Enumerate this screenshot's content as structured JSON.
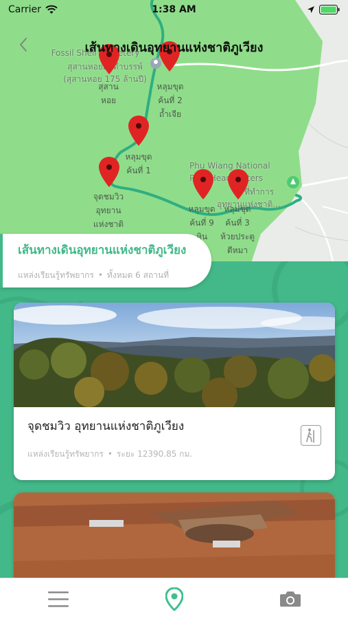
{
  "status_bar": {
    "carrier": "Carrier",
    "time": "1:38 AM",
    "icons": [
      "wifi-icon",
      "location-arrow-icon",
      "battery-icon"
    ]
  },
  "map": {
    "title": "เส้นทางเดินอุทยานแห่งชาติภูเวียง",
    "places": [
      {
        "label": "Fossil Shell Cemetery"
      },
      {
        "label": "สุสานหอยดึกดำบรรพ์"
      },
      {
        "label": "(สุสานหอย 175 ล้านปี)"
      },
      {
        "label": "Phu Wiang National Park Headquaters"
      },
      {
        "label": "ที่ทำการ"
      },
      {
        "label": "อุทยานแห่งชาติ..."
      }
    ],
    "pins": [
      {
        "label": "สุสาน\nหอย"
      },
      {
        "label": "หลุมขุด\nค้นที่ 2\nถ้ำเจีย"
      },
      {
        "label": "หลุมขุด\nค้นที่ 1"
      },
      {
        "label": "จุดชมวิว\nอุทยาน\nแห่งชาติ"
      },
      {
        "label": "หลุมขุด\nค้นที่ 9\nหิน"
      },
      {
        "label": "หลุมขุด\nค้นที่ 3\nห้วยประตู\nตีหมา"
      }
    ],
    "colors": {
      "land": "#8fdd8a",
      "route": "#2fae82",
      "pin": "#e02424",
      "road": "#ffffff"
    }
  },
  "route_card": {
    "title": "เส้นทางเดินอุทยานแห่งชาติภูเวียง",
    "category": "แหล่งเรียนรู้ทรัพยากร",
    "count": "ทั้งหมด 6 สถานที่"
  },
  "cards": [
    {
      "title": "จุดชมวิว อุทยานแห่งชาติภูเวียง",
      "category": "แหล่งเรียนรู้ทรัพยากร",
      "distance": "ระยะ 12390.85 กม.",
      "icon": "hiking-icon"
    },
    {
      "title": "",
      "category": "",
      "distance": "",
      "icon": ""
    }
  ],
  "tab_bar": {
    "tabs": [
      {
        "icon": "menu-icon",
        "active": false
      },
      {
        "icon": "map-pin-icon",
        "active": true
      },
      {
        "icon": "camera-icon",
        "active": false
      }
    ]
  },
  "theme": {
    "accent": "#43b889",
    "text": "#222222",
    "muted": "#b5b5b5"
  }
}
